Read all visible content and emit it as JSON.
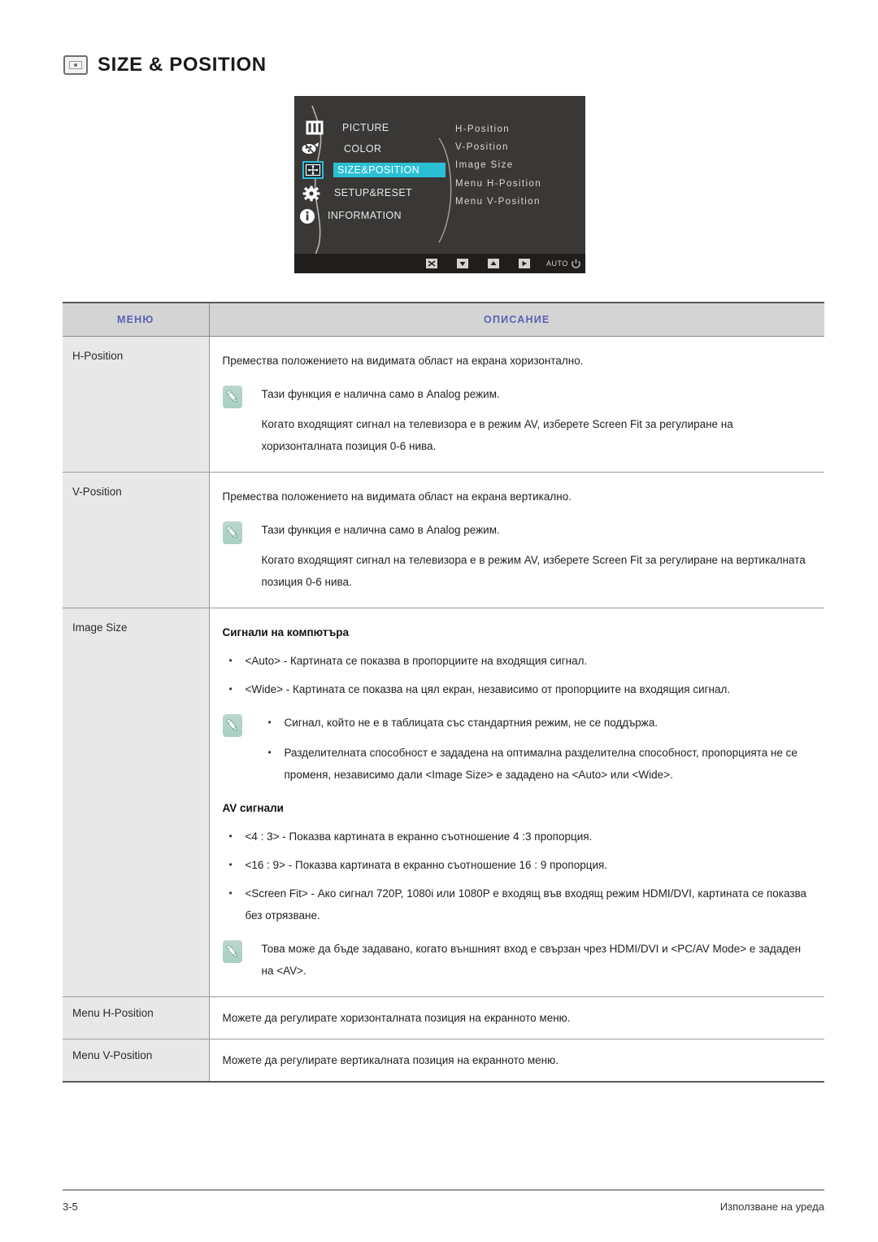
{
  "page": {
    "title": "SIZE & POSITION",
    "title_icon": "size-position-icon",
    "footer_left": "3-5",
    "footer_right": "Използване на уреда"
  },
  "osd": {
    "left_menu": [
      {
        "icon": "picture-icon",
        "label": "PICTURE",
        "selected": false
      },
      {
        "icon": "color-icon",
        "label": "COLOR",
        "selected": false
      },
      {
        "icon": "size-position-icon",
        "label": "SIZE&POSITION",
        "selected": true
      },
      {
        "icon": "setup-reset-icon",
        "label": "SETUP&RESET",
        "selected": false
      },
      {
        "icon": "information-icon",
        "label": "INFORMATION",
        "selected": false
      }
    ],
    "submenu": [
      "H-Position",
      "V-Position",
      "Image Size",
      "Menu H-Position",
      "Menu V-Position"
    ],
    "bottom_bar": [
      {
        "icon": "exit-icon",
        "label": ""
      },
      {
        "icon": "down-arrow-icon",
        "label": ""
      },
      {
        "icon": "up-arrow-icon",
        "label": ""
      },
      {
        "icon": "enter-icon",
        "label": ""
      },
      {
        "icon": "auto-icon",
        "label": "AUTO"
      },
      {
        "icon": "power-icon",
        "label": ""
      }
    ],
    "highlight_color": "#2bbfd4",
    "background_color": "#3a3836"
  },
  "table": {
    "header": {
      "menu": "МЕНЮ",
      "description": "ОПИСАНИЕ"
    },
    "rows": [
      {
        "menu": "H-Position",
        "intro": "Премества положението на видимата област на екрана хоризонтално.",
        "note_line1": "Тази функция е налична само в Analog режим.",
        "note_line2": "Когато входящият сигнал на телевизора е в режим AV, изберете Screen Fit  за регулиране на хоризонталната позиция 0-6 нива."
      },
      {
        "menu": "V-Position",
        "intro": "Премества положението на видимата област на екрана вертикално.",
        "note_line1": "Тази функция е налична само в Analog режим.",
        "note_line2": "Когато входящият сигнал на телевизора е в режим AV, изберете Screen Fit  за регулиране на вертикалната позиция 0-6 нива."
      },
      {
        "menu": "Image Size",
        "pc_heading": "Сигнали на компютъра",
        "pc_bullets": [
          "<Auto> - Картината се показва в пропорциите на входящия сигнал.",
          "<Wide> - Картината се показва на цял екран, независимо от пропорциите на входящия сигнал."
        ],
        "pc_note_bullets": [
          "Сигнал, който не е в таблицата със стандартния режим, не се поддържа.",
          "Разделителната способност е зададена на оптимална разделителна способност, пропорцията не се променя, независимо дали <Image Size> е зададено на <Auto> или <Wide>."
        ],
        "av_heading": "AV сигнали",
        "av_bullets": [
          "<4 : 3> - Показва картината в екранно съотношение 4 :3 пропорция.",
          "<16 : 9> - Показва картината в екранно съотношение 16 : 9 пропорция.",
          "<Screen Fit> - Ако сигнал 720P, 1080i или 1080P е входящ във входящ режим HDMI/DVI, картината се показва без отрязване."
        ],
        "av_note": "Това може да бъде задавано, когато външният вход е свързан чрез HDMI/DVI и <PC/AV Mode> е зададен на <AV>."
      },
      {
        "menu": "Menu H-Position",
        "intro": "Можете да регулирате хоризонталната позиция на екранното меню."
      },
      {
        "menu": "Menu V-Position",
        "intro": "Можете да регулирате вертикалната позиция на екранното меню."
      }
    ]
  }
}
